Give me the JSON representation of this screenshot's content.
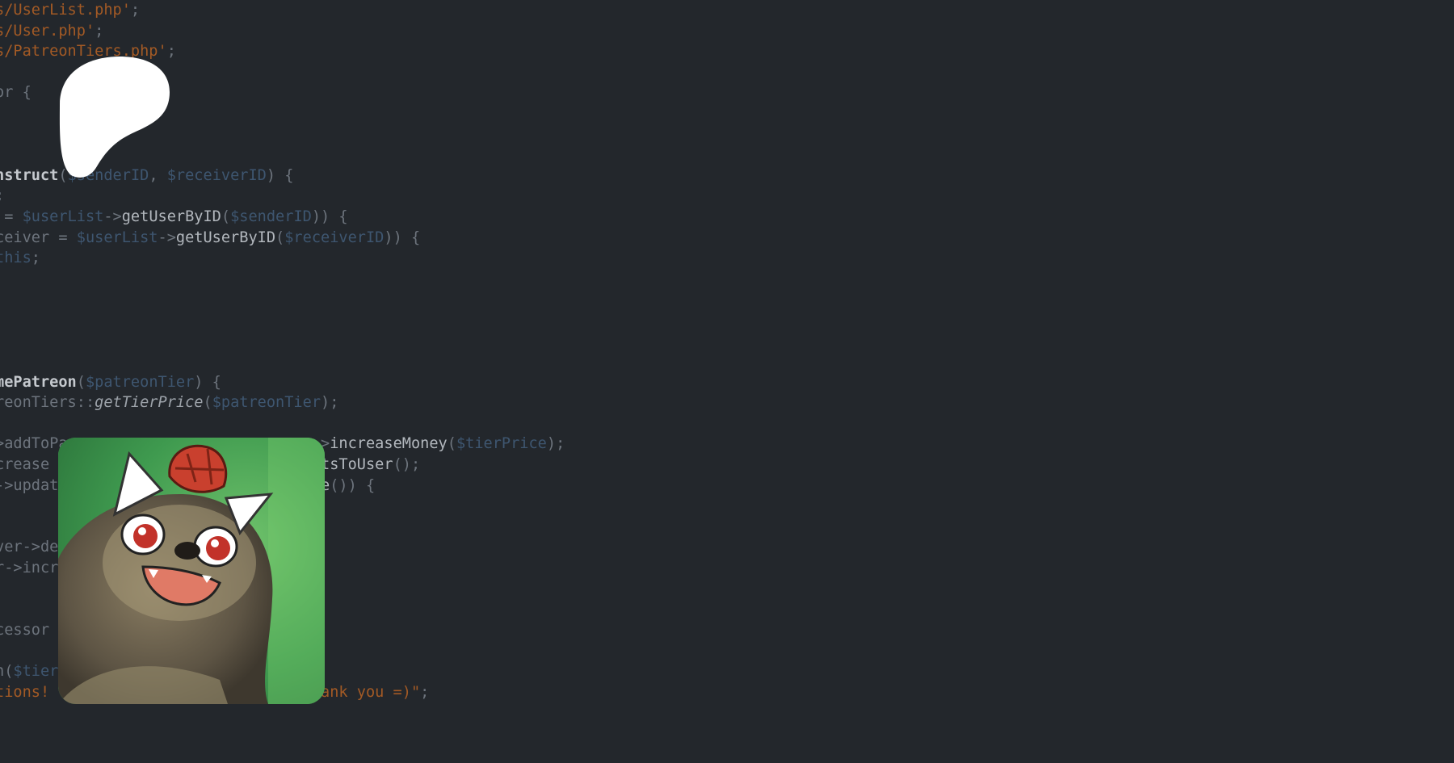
{
  "code_lines": [
    [
      {
        "t": "s/UserList.php'",
        "c": "str"
      },
      {
        "t": ";",
        "c": ""
      }
    ],
    [
      {
        "t": "s/User.php'",
        "c": "str"
      },
      {
        "t": ";",
        "c": ""
      }
    ],
    [
      {
        "t": "s/PatreonTiers.php'",
        "c": "str"
      },
      {
        "t": ";",
        "c": ""
      }
    ],
    [
      {
        "t": "",
        "c": ""
      }
    ],
    [
      {
        "t": "or {",
        "c": ""
      }
    ],
    [
      {
        "t": "",
        "c": ""
      }
    ],
    [
      {
        "t": "",
        "c": ""
      }
    ],
    [
      {
        "t": "",
        "c": ""
      }
    ],
    [
      {
        "t": "nstruct",
        "c": "kw"
      },
      {
        "t": "(",
        "c": ""
      },
      {
        "t": "$senderID",
        "c": "var"
      },
      {
        "t": ", ",
        "c": ""
      },
      {
        "t": "$receiverID",
        "c": "var"
      },
      {
        "t": ") {",
        "c": ""
      }
    ],
    [
      {
        "t": ";",
        "c": ""
      }
    ],
    [
      {
        "t": " = ",
        "c": ""
      },
      {
        "t": "$userList",
        "c": "var"
      },
      {
        "t": "->",
        "c": ""
      },
      {
        "t": "getUserByID",
        "c": "fn"
      },
      {
        "t": "(",
        "c": ""
      },
      {
        "t": "$senderID",
        "c": "var"
      },
      {
        "t": ")) {",
        "c": ""
      }
    ],
    [
      {
        "t": "ceiver = ",
        "c": ""
      },
      {
        "t": "$userList",
        "c": "var"
      },
      {
        "t": "->",
        "c": ""
      },
      {
        "t": "getUserByID",
        "c": "fn"
      },
      {
        "t": "(",
        "c": ""
      },
      {
        "t": "$receiverID",
        "c": "var"
      },
      {
        "t": ")) {",
        "c": ""
      }
    ],
    [
      {
        "t": "this",
        "c": "var"
      },
      {
        "t": ";",
        "c": ""
      }
    ],
    [
      {
        "t": "",
        "c": ""
      }
    ],
    [
      {
        "t": "",
        "c": ""
      }
    ],
    [
      {
        "t": "",
        "c": ""
      }
    ],
    [
      {
        "t": "",
        "c": ""
      }
    ],
    [
      {
        "t": "",
        "c": ""
      }
    ],
    [
      {
        "t": "mePatreon",
        "c": "kw"
      },
      {
        "t": "(",
        "c": ""
      },
      {
        "t": "$patreonTier",
        "c": "var"
      },
      {
        "t": ") {",
        "c": ""
      }
    ],
    [
      {
        "t": "reonTiers::",
        "c": ""
      },
      {
        "t": "getTierPrice",
        "c": "it"
      },
      {
        "t": "(",
        "c": ""
      },
      {
        "t": "$patreonTier",
        "c": "var"
      },
      {
        "t": ");",
        "c": ""
      }
    ],
    [
      {
        "t": "",
        "c": ""
      }
    ],
    [
      {
        "t": ">addToPa",
        "c": ""
      },
      {
        "t": "                           ",
        "c": ""
      },
      {
        "t": "->",
        "c": ""
      },
      {
        "t": "increaseMoney",
        "c": "fn"
      },
      {
        "t": "(",
        "c": ""
      },
      {
        "t": "$tierPrice",
        "c": "var"
      },
      {
        "t": ");",
        "c": ""
      }
    ],
    [
      {
        "t": "crease",
        "c": ""
      },
      {
        "t": "                             ",
        "c": ""
      },
      {
        "t": "itsToUser",
        "c": "fn"
      },
      {
        "t": "();",
        "c": ""
      }
    ],
    [
      {
        "t": "->updat",
        "c": ""
      },
      {
        "t": "                           ",
        "c": ""
      },
      {
        "t": "ate",
        "c": "fn"
      },
      {
        "t": "()) {",
        "c": ""
      }
    ],
    [
      {
        "t": "",
        "c": ""
      }
    ],
    [
      {
        "t": "",
        "c": ""
      }
    ],
    [
      {
        "t": "ver->de",
        "c": ""
      }
    ],
    [
      {
        "t": "r->incr",
        "c": ""
      }
    ],
    [
      {
        "t": "",
        "c": ""
      }
    ],
    [
      {
        "t": "",
        "c": ""
      }
    ],
    [
      {
        "t": "cessor",
        "c": ""
      }
    ],
    [
      {
        "t": "",
        "c": ""
      }
    ],
    [
      {
        "t": "n(",
        "c": ""
      },
      {
        "t": "$tier",
        "c": "var"
      }
    ],
    [
      {
        "t": "tions! You have become a patreon! Thank you =)\"",
        "c": "str"
      },
      {
        "t": ";",
        "c": ""
      }
    ]
  ],
  "colors": {
    "background": "#23272c",
    "plain": "#6d747d",
    "string": "#a35a25",
    "variable": "#3e5670",
    "keyword": "#c5c9ce",
    "logo": "#ffffff"
  },
  "icons": {
    "logo": "patreon-logo-icon",
    "avatar": "sloth-mascot-avatar"
  }
}
